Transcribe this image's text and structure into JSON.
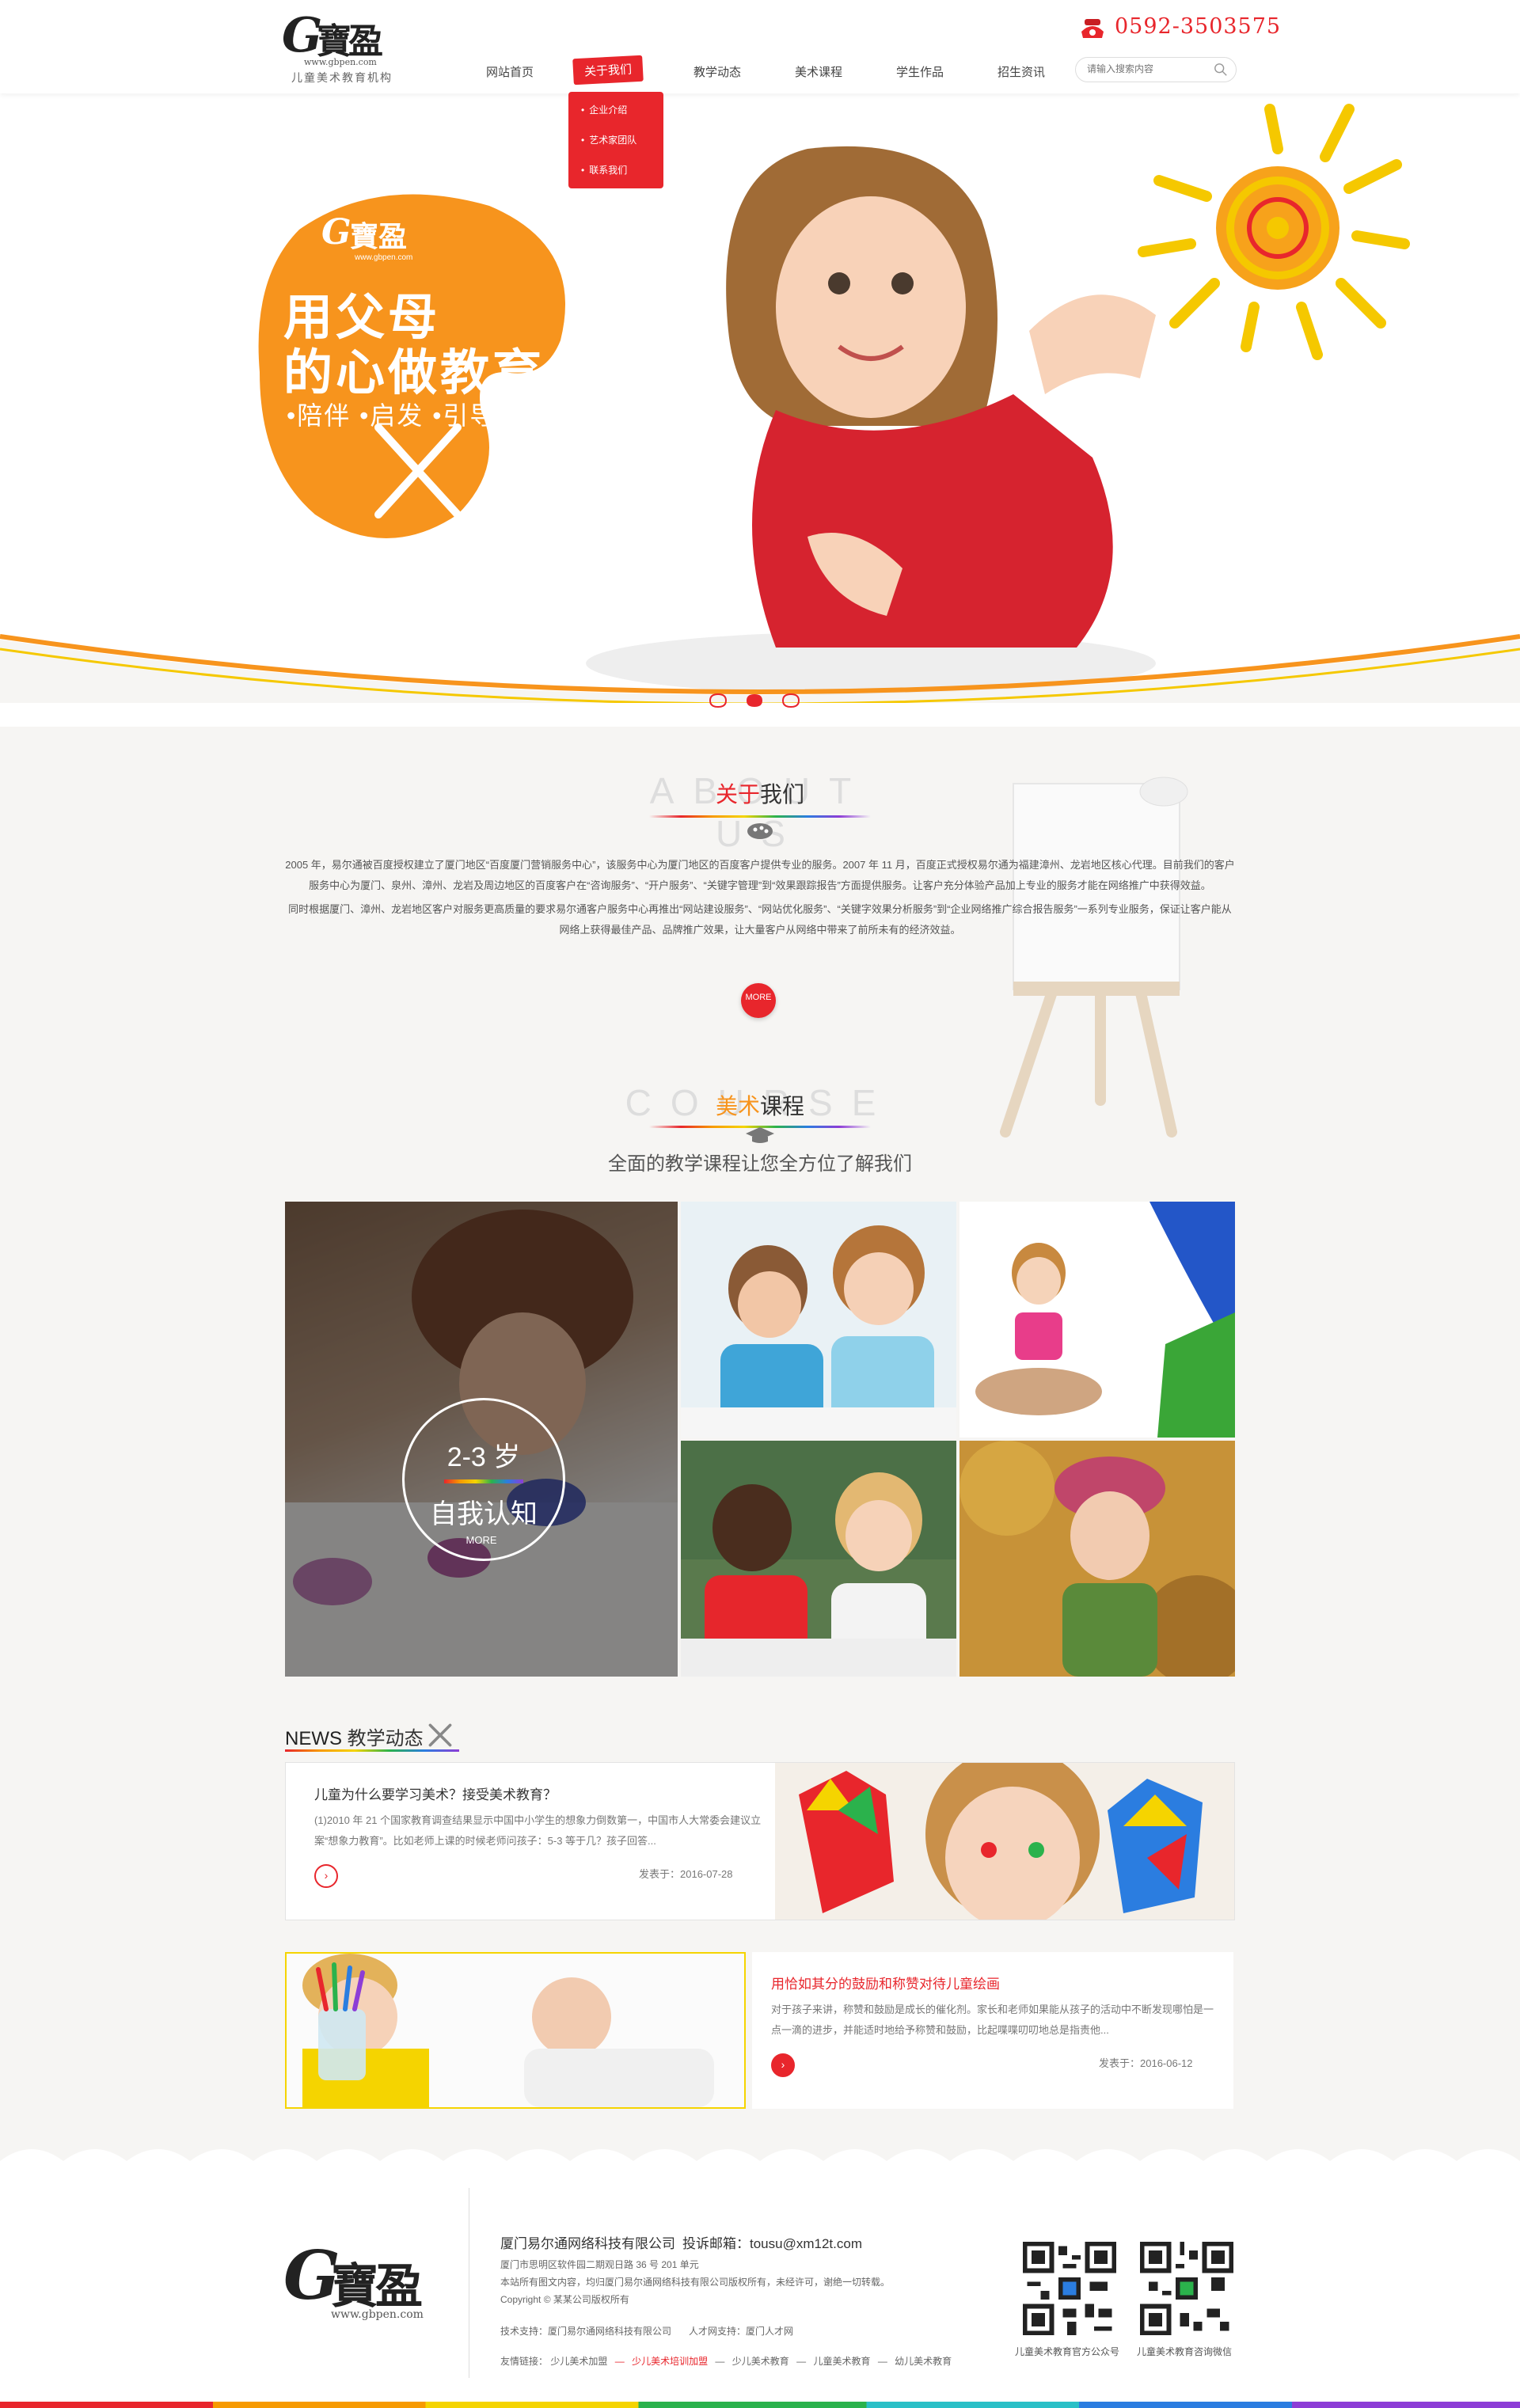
{
  "brand": {
    "logo_g": "G",
    "logo_cn": "寶盈",
    "logo_url": "www.gbpen.com",
    "tagline": "儿童美术教育机构"
  },
  "nav": {
    "items": [
      "网站首页",
      "关于我们",
      "教学动态",
      "美术课程",
      "学生作品",
      "招生资讯"
    ],
    "active_index": 1
  },
  "dropdown": {
    "items": [
      "企业介绍",
      "艺术家团队",
      "联系我们"
    ]
  },
  "header": {
    "phone": "0592-3503575",
    "search_placeholder": "请输入搜索内容"
  },
  "banner": {
    "palette_line1": "用父母",
    "palette_line2": "的心做教育",
    "palette_line3": "•陪伴 •启发 •引导 •帮助",
    "slides": 3,
    "active_slide": 1
  },
  "about": {
    "bg_text": "ABOUT US",
    "title_hl": "关于",
    "title_rest": "我们",
    "para1": "2005 年，易尔通被百度授权建立了厦门地区“百度厦门营销服务中心”，该服务中心为厦门地区的百度客户提供专业的服务。2007 年 11 月，百度正式授权易尔通为福建漳州、龙岩地区核心代理。目前我们的客户服务中心为厦门、泉州、漳州、龙岩及周边地区的百度客户在“咨询服务”、“开户服务”、“关键字管理”到“效果跟踪报告”方面提供服务。让客户充分体验产品加上专业的服务才能在网络推广中获得效益。",
    "para2": "同时根据厦门、漳州、龙岩地区客户对服务更高质量的要求易尔通客户服务中心再推出“网站建设服务”、“网站优化服务”、“关键字效果分析服务”到“企业网络推广综合报告服务”一系列专业服务，保证让客户能从网络上获得最佳产品、品牌推广效果，让大量客户从网络中带来了前所未有的经济效益。",
    "more": "MORE"
  },
  "courses": {
    "bg_text": "COURSE",
    "title_hl": "美术",
    "title_rest": "课程",
    "subtitle": "全面的教学课程让您全方位了解我们",
    "featured_age": "2-3 岁",
    "featured_label": "自我认知",
    "featured_more": "MORE"
  },
  "news": {
    "title_en": "NEWS",
    "title_cn": "教学动态",
    "items": [
      {
        "title": "儿童为什么要学习美术？接受美术教育？",
        "excerpt": "(1)2010 年 21 个国家教育调查结果显示中国中小学生的想象力倒数第一，中国市人大常委会建议立案“想象力教育”。比如老师上课的时候老师问孩子：5-3 等于几？孩子回答...",
        "date": "发表于：2016-07-28"
      },
      {
        "title": "用恰如其分的鼓励和称赞对待儿童绘画",
        "excerpt": "对于孩子来讲，称赞和鼓励是成长的催化剂。家长和老师如果能从孩子的活动中不断发现哪怕是一点一滴的进步，并能适时地给予称赞和鼓励，比起喋喋叨叨地总是指责他...",
        "date": "发表于：2016-06-12"
      }
    ]
  },
  "footer": {
    "company": "厦门易尔通网络科技有限公司",
    "complaint": "投诉邮箱：tousu@xm12t.com",
    "address": "厦门市思明区软件园二期观日路 36 号 201 单元",
    "copyright_note": "本站所有图文内容，均归厦门易尔通网络科技有限公司版权所有，未经许可，谢绝一切转载。",
    "copyright": "Copyright © 某某公司版权所有",
    "tech_support": "技术支持：厦门易尔通网络科技有限公司",
    "talent_support": "人才网支持：厦门人才网",
    "links_label": "友情链接：",
    "links": [
      "少儿美术加盟",
      "少儿美术培训加盟",
      "少儿美术教育",
      "儿童美术教育",
      "幼儿美术教育"
    ],
    "qr1_label": "儿童美术教育官方公众号",
    "qr2_label": "儿童美术教育咨询微信"
  },
  "colors": {
    "accent_red": "#e8262c",
    "orange": "#f7941d",
    "background": "#f6f5f3"
  }
}
